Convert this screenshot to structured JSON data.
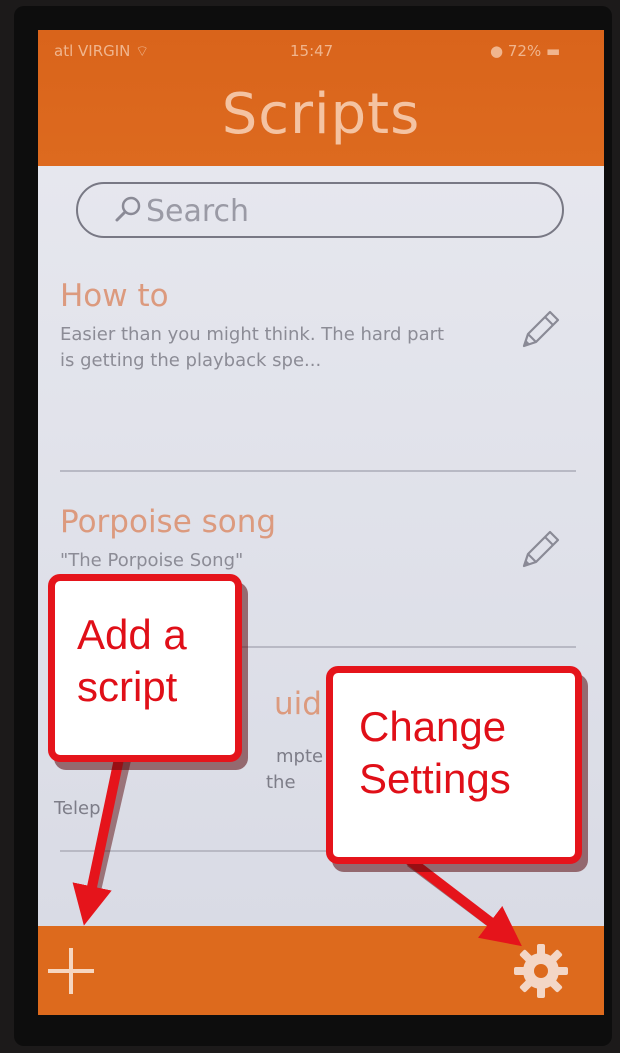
{
  "status_bar": {
    "carrier": "atl VIRGIN ⌔",
    "time": "15:47",
    "battery": "● 72% ▬"
  },
  "header": {
    "title": "Scripts"
  },
  "search": {
    "placeholder": "Search"
  },
  "scripts": [
    {
      "title": "How to",
      "description": "Easier than you might think. The hard part is getting the playback spe..."
    },
    {
      "title": "Porpoise song",
      "description": "\"The Porpoise Song\""
    }
  ],
  "partial_item": {
    "title_fragment": "uid",
    "desc_fragment_1": "mpte",
    "desc_fragment_2": "the",
    "desc_fragment_3": "Telep"
  },
  "annotations": {
    "add_script": {
      "line1": "Add a",
      "line2": "script"
    },
    "change_settings": {
      "line1": "Change",
      "line2": "Settings"
    }
  },
  "footer": {
    "add_icon": "plus-icon",
    "settings_icon": "gear-icon"
  },
  "colors": {
    "accent": "#dd6a1d",
    "callout_border": "#e5141b",
    "callout_text": "#e00f18"
  }
}
